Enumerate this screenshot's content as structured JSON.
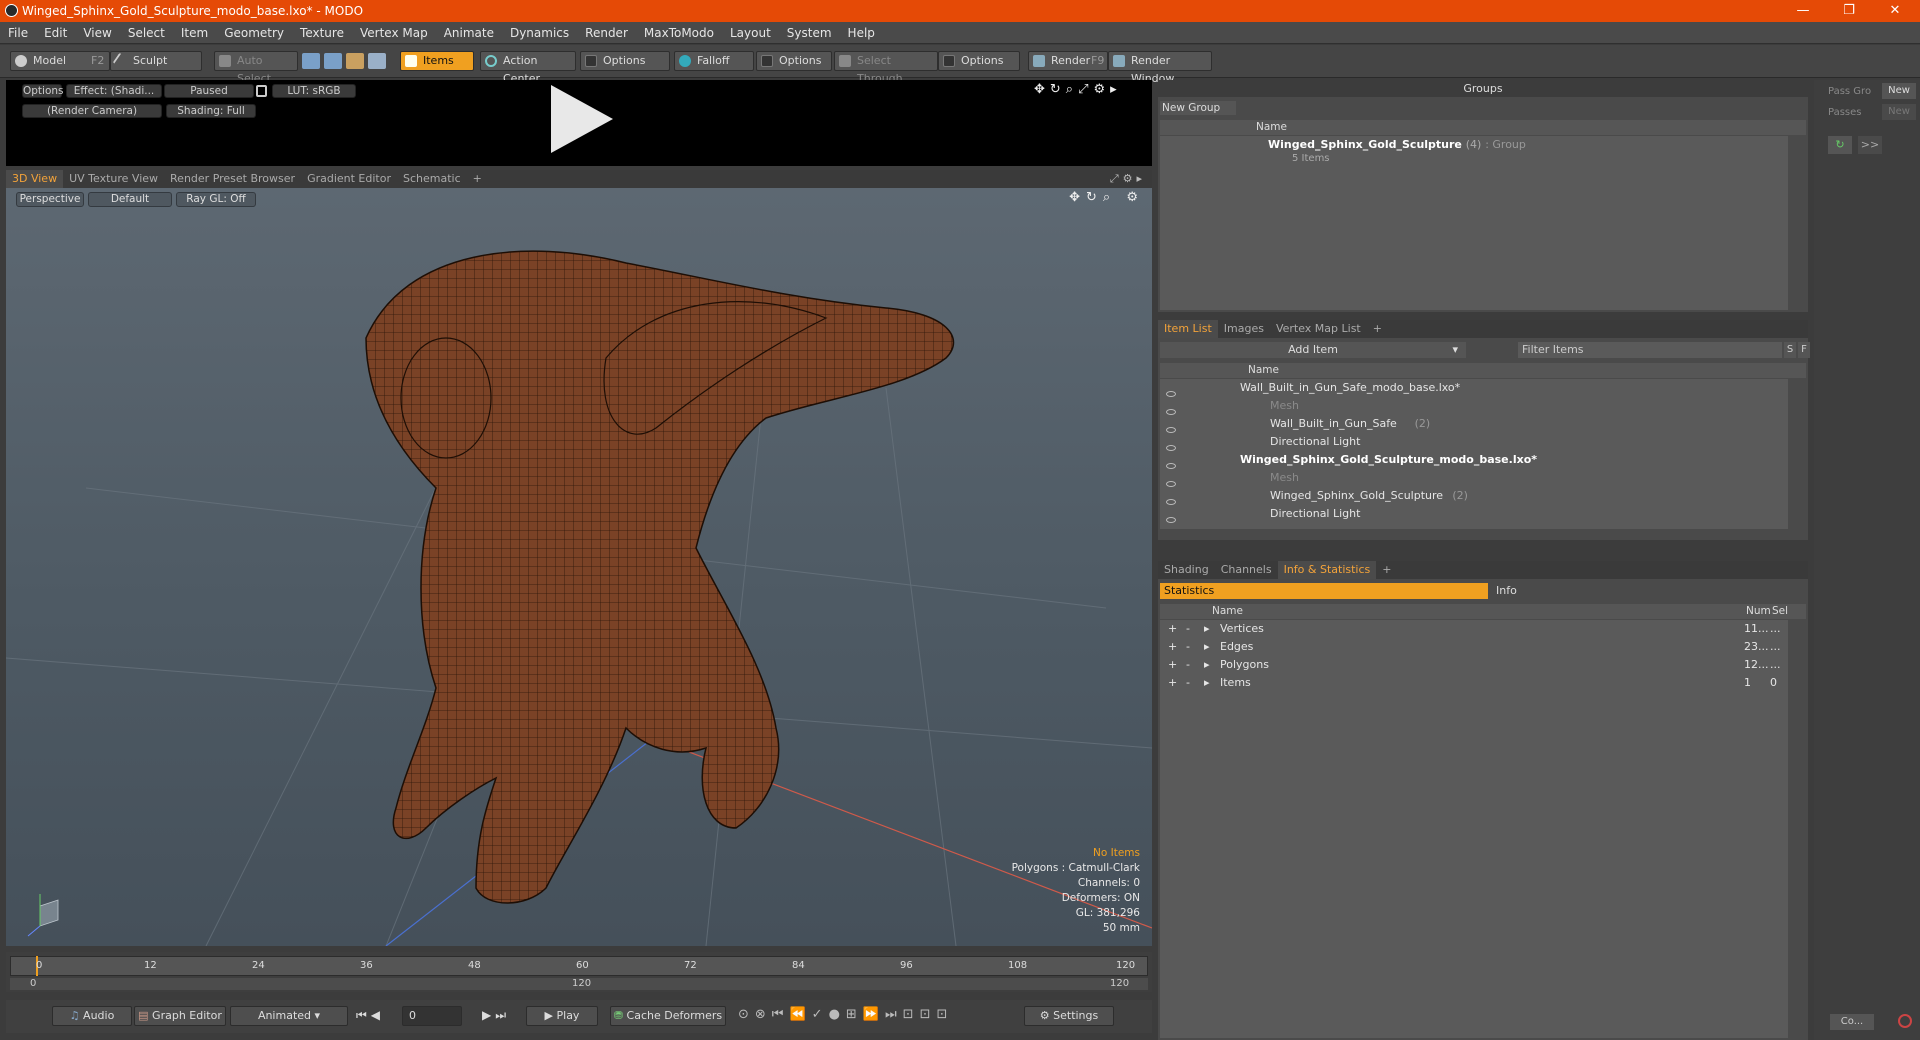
{
  "window": {
    "title": "Winged_Sphinx_Gold_Sculpture_modo_base.lxo* - MODO",
    "minimize": "—",
    "maximize": "❐",
    "close": "✕"
  },
  "menu": [
    "File",
    "Edit",
    "View",
    "Select",
    "Item",
    "Geometry",
    "Texture",
    "Vertex Map",
    "Animate",
    "Dynamics",
    "Render",
    "MaxToModo",
    "Layout",
    "System",
    "Help"
  ],
  "toolbar": {
    "model": "Model",
    "model_key": "F2",
    "sculpt": "Sculpt",
    "auto_select": "Auto Select",
    "items": "Items",
    "action_center": "Action Center",
    "options1": "Options",
    "falloff": "Falloff",
    "options2": "Options",
    "select_through": "Select Through",
    "options3": "Options",
    "render": "Render",
    "render_key": "F9",
    "render_window": "Render Window"
  },
  "preview": {
    "options": "Options",
    "effect": "Effect: (Shadi...",
    "paused": "Paused",
    "lut": "LUT: sRGB",
    "camera": "(Render Camera)",
    "shading": "Shading: Full"
  },
  "viewport_tabs": [
    "3D View",
    "UV Texture View",
    "Render Preset Browser",
    "Gradient Editor",
    "Schematic",
    "+"
  ],
  "viewport": {
    "perspective": "Perspective",
    "default": "Default",
    "raygl": "Ray GL: Off",
    "info": {
      "noitems": "No Items",
      "polygons": "Polygons : Catmull-Clark",
      "channels": "Channels: 0",
      "deformers": "Deformers: ON",
      "gl": "GL: 381,296",
      "lens": "50 mm"
    }
  },
  "timeline": {
    "ticks": [
      "0",
      "12",
      "24",
      "36",
      "48",
      "60",
      "72",
      "84",
      "96",
      "108",
      "120"
    ],
    "range_start": "0",
    "range_mid": "120",
    "range_end": "120"
  },
  "bottombar": {
    "audio": "Audio",
    "graph_editor": "Graph Editor",
    "animated": "Animated",
    "frame": "0",
    "play": "Play",
    "cache": "Cache Deformers",
    "settings": "Settings"
  },
  "groups": {
    "title": "Groups",
    "new_group": "New Group",
    "col_name": "Name",
    "item_name": "Winged_Sphinx_Gold_Sculpture",
    "item_count": "(4)",
    "item_type": ": Group",
    "item_sub": "5 Items"
  },
  "pass": {
    "pass_groups": "Pass Gro",
    "new1": "New",
    "passes": "Passes",
    "new2": "New",
    "more": ">>",
    "co": "Co..."
  },
  "itemlist": {
    "tabs": [
      "Item List",
      "Images",
      "Vertex Map List",
      "+"
    ],
    "add_item": "Add Item",
    "filter": "Filter Items",
    "s": "S",
    "f": "F",
    "col_name": "Name",
    "rows": [
      {
        "label": "Wall_Built_in_Gun_Safe_modo_base.lxo*",
        "count": "",
        "bold": false
      },
      {
        "label": "Mesh",
        "count": "",
        "bold": false
      },
      {
        "label": "Wall_Built_in_Gun_Safe",
        "count": "(2)",
        "bold": false
      },
      {
        "label": "Directional Light",
        "count": "",
        "bold": false
      },
      {
        "label": "Winged_Sphinx_Gold_Sculpture_modo_base.lxo*",
        "count": "",
        "bold": true
      },
      {
        "label": "Mesh",
        "count": "",
        "bold": false
      },
      {
        "label": "Winged_Sphinx_Gold_Sculpture",
        "count": "(2)",
        "bold": false
      },
      {
        "label": "Directional Light",
        "count": "",
        "bold": false
      }
    ]
  },
  "info": {
    "tabs": [
      "Shading",
      "Channels",
      "Info & Statistics",
      "+"
    ],
    "statistics": "Statistics",
    "info": "Info",
    "col_name": "Name",
    "col_num": "Num",
    "col_sel": "Sel",
    "rows": [
      {
        "name": "Vertices",
        "num": "11...",
        "sel": "..."
      },
      {
        "name": "Edges",
        "num": "23...",
        "sel": "..."
      },
      {
        "name": "Polygons",
        "num": "12...",
        "sel": "..."
      },
      {
        "name": "Items",
        "num": "1",
        "sel": "0"
      }
    ]
  }
}
